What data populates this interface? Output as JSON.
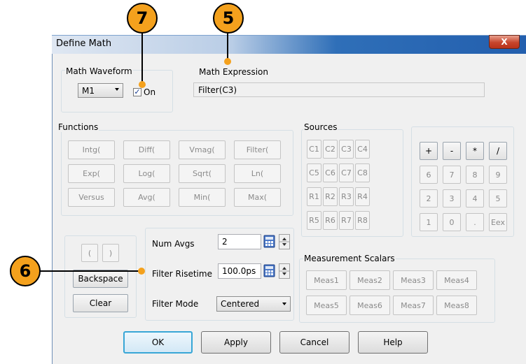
{
  "dialog": {
    "title": "Define Math",
    "close_label": "X"
  },
  "waveform": {
    "group_label": "Math Waveform",
    "selected": "M1",
    "on_label": "On",
    "on_checked": true
  },
  "expression": {
    "label": "Math Expression",
    "value": "Filter(C3)"
  },
  "functions": {
    "group_label": "Functions",
    "items": [
      "Intg(",
      "Diff(",
      "Vmag(",
      "Filter(",
      "Exp(",
      "Log(",
      "Sqrt(",
      "Ln(",
      "Versus",
      "Avg(",
      "Min(",
      "Max("
    ]
  },
  "sources": {
    "group_label": "Sources",
    "items": [
      "C1",
      "C2",
      "C3",
      "C4",
      "C5",
      "C6",
      "C7",
      "C8",
      "R1",
      "R2",
      "R3",
      "R4",
      "R5",
      "R6",
      "R7",
      "R8"
    ]
  },
  "keypad": {
    "items": [
      "+",
      "-",
      "*",
      "/",
      "6",
      "7",
      "8",
      "9",
      "2",
      "3",
      "4",
      "5",
      "1",
      "0",
      ".",
      "Eex"
    ]
  },
  "editing": {
    "open_paren": "(",
    "close_paren": ")",
    "backspace": "Backspace",
    "clear": "Clear"
  },
  "filter": {
    "num_avgs_label": "Num Avgs",
    "num_avgs_value": "2",
    "risetime_label": "Filter Risetime",
    "risetime_value": "100.0ps",
    "mode_label": "Filter Mode",
    "mode_value": "Centered"
  },
  "scalars": {
    "group_label": "Measurement Scalars",
    "items": [
      "Meas1",
      "Meas2",
      "Meas3",
      "Meas4",
      "Meas5",
      "Meas6",
      "Meas7",
      "Meas8"
    ]
  },
  "footer": {
    "ok": "OK",
    "apply": "Apply",
    "cancel": "Cancel",
    "help": "Help"
  },
  "callouts": {
    "enable": "7",
    "expression": "5",
    "filter": "6"
  },
  "colors": {
    "callout": "#f4a11d",
    "title_bar": "#235fae",
    "close_button": "#c7452c"
  }
}
